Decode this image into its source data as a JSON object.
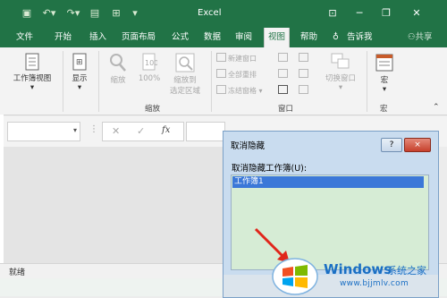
{
  "titlebar": {
    "app_title": "Excel",
    "qat": [
      "save-icon",
      "undo-icon",
      "redo-icon",
      "form-icon",
      "table-icon",
      "customize-icon"
    ],
    "controls": [
      "ribbon-display-icon",
      "minimize-icon",
      "restore-icon",
      "close-icon"
    ]
  },
  "tabs": [
    "文件",
    "开始",
    "插入",
    "页面布局",
    "公式",
    "数据",
    "审阅",
    "视图",
    "帮助",
    "告诉我",
    "共享"
  ],
  "active_tab": "视图",
  "ribbon": {
    "workbook_views": "工作簿视图",
    "show": "显示",
    "zoom": "缩放",
    "zoom_100": "100%",
    "zoom_sel_1": "缩放到",
    "zoom_sel_2": "选定区域",
    "new_window": "新建窗口",
    "arrange_all": "全部重排",
    "freeze_panes": "冻结窗格",
    "switch_windows": "切换窗口",
    "macros": "宏",
    "group_zoom": "缩放",
    "group_window": "窗口",
    "group_macros": "宏"
  },
  "formula_bar": {
    "fx": "fx"
  },
  "status": {
    "ready": "就绪"
  },
  "dialog": {
    "title": "取消隐藏",
    "help": "?",
    "close": "×",
    "label": "取消隐藏工作簿(U):",
    "items": [
      "工作簿1"
    ]
  },
  "watermark": {
    "brand": "Windows",
    "cn": "系统之家",
    "url": "www.bjjmlv.com"
  }
}
